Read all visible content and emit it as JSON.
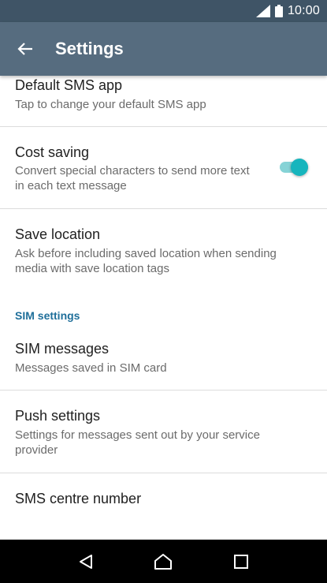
{
  "status_bar": {
    "time": "10:00",
    "icons": [
      "signal-icon",
      "battery-icon"
    ]
  },
  "app_bar": {
    "title": "Settings",
    "back_icon": "arrow-left-icon"
  },
  "settings": {
    "default_sms": {
      "title": "Default SMS app",
      "summary": "Tap to change your default SMS app"
    },
    "cost_saving": {
      "title": "Cost saving",
      "summary": "Convert special characters to send more text in each text message",
      "toggle_on": true
    },
    "save_location": {
      "title": "Save location",
      "summary": "Ask before including saved location when sending media with save location tags"
    },
    "sim_section_header": "SIM settings",
    "sim_messages": {
      "title": "SIM messages",
      "summary": "Messages saved in SIM card"
    },
    "push_settings": {
      "title": "Push settings",
      "summary": "Settings for messages sent out by your service provider"
    },
    "sms_centre": {
      "title": "SMS centre number"
    }
  },
  "nav_bar": {
    "icons": [
      "back-triangle-icon",
      "home-icon",
      "recents-icon"
    ]
  },
  "colors": {
    "status_bar": "#3f5466",
    "app_bar": "#566c7f",
    "accent": "#17b5bd",
    "section_header": "#1f6f9a"
  }
}
